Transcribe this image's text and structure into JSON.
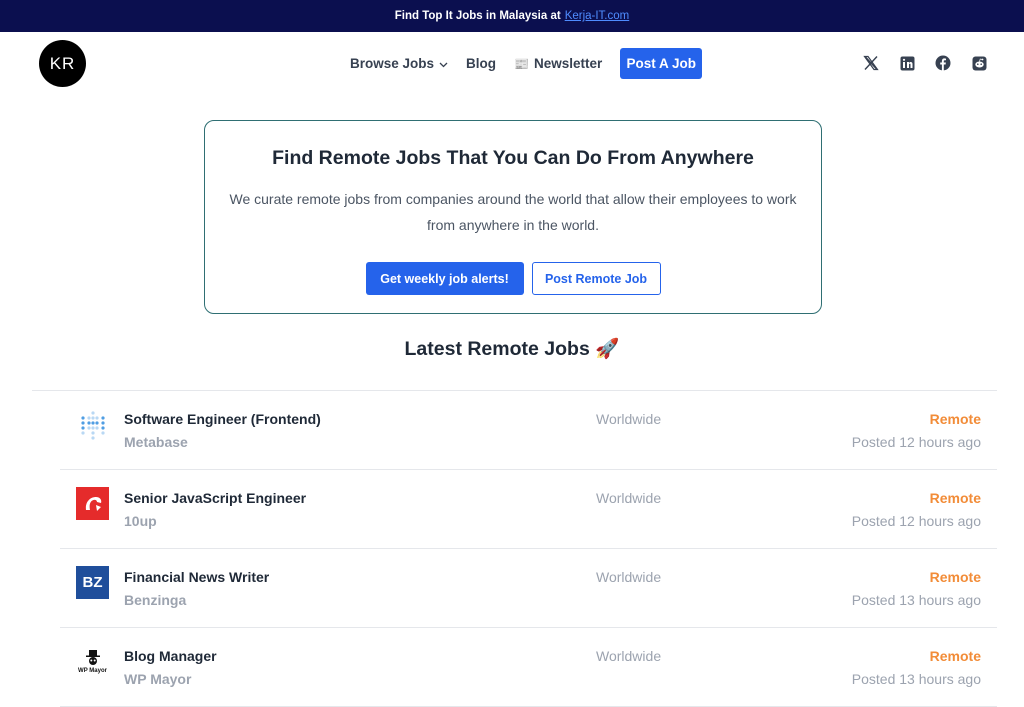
{
  "topbar": {
    "text": "Find Top It Jobs in Malaysia at",
    "link_text": "Kerja-IT.com"
  },
  "header": {
    "logo_text": "KR",
    "nav": {
      "browse_jobs": "Browse Jobs",
      "blog": "Blog",
      "newsletter_emoji": "📰",
      "newsletter": "Newsletter",
      "post_job": "Post A Job"
    },
    "social_icons": [
      "x-icon",
      "linkedin-icon",
      "facebook-icon",
      "reddit-icon"
    ]
  },
  "hero": {
    "title": "Find Remote Jobs That You Can Do From Anywhere",
    "description": "We curate remote jobs from companies around the world that allow their employees to work from anywhere in the world.",
    "primary_button": "Get weekly job alerts!",
    "secondary_button": "Post Remote Job"
  },
  "latest": {
    "title": "Latest Remote Jobs 🚀"
  },
  "jobs": [
    {
      "title": "Software Engineer (Frontend)",
      "company": "Metabase",
      "location": "Worldwide",
      "type": "Remote",
      "posted": "Posted 12 hours ago"
    },
    {
      "title": "Senior JavaScript Engineer",
      "company": "10up",
      "location": "Worldwide",
      "type": "Remote",
      "posted": "Posted 12 hours ago"
    },
    {
      "title": "Financial News Writer",
      "company": "Benzinga",
      "location": "Worldwide",
      "type": "Remote",
      "posted": "Posted 13 hours ago"
    },
    {
      "title": "Blog Manager",
      "company": "WP Mayor",
      "location": "Worldwide",
      "type": "Remote",
      "posted": "Posted 13 hours ago"
    }
  ],
  "logos": {
    "benzinga": "BZ",
    "wpmayor": "WP Mayor"
  },
  "colors": {
    "topbar_bg": "#0b0f4f",
    "primary": "#2563eb",
    "remote_tag": "#f28c38",
    "hero_border": "#2f6f73"
  }
}
